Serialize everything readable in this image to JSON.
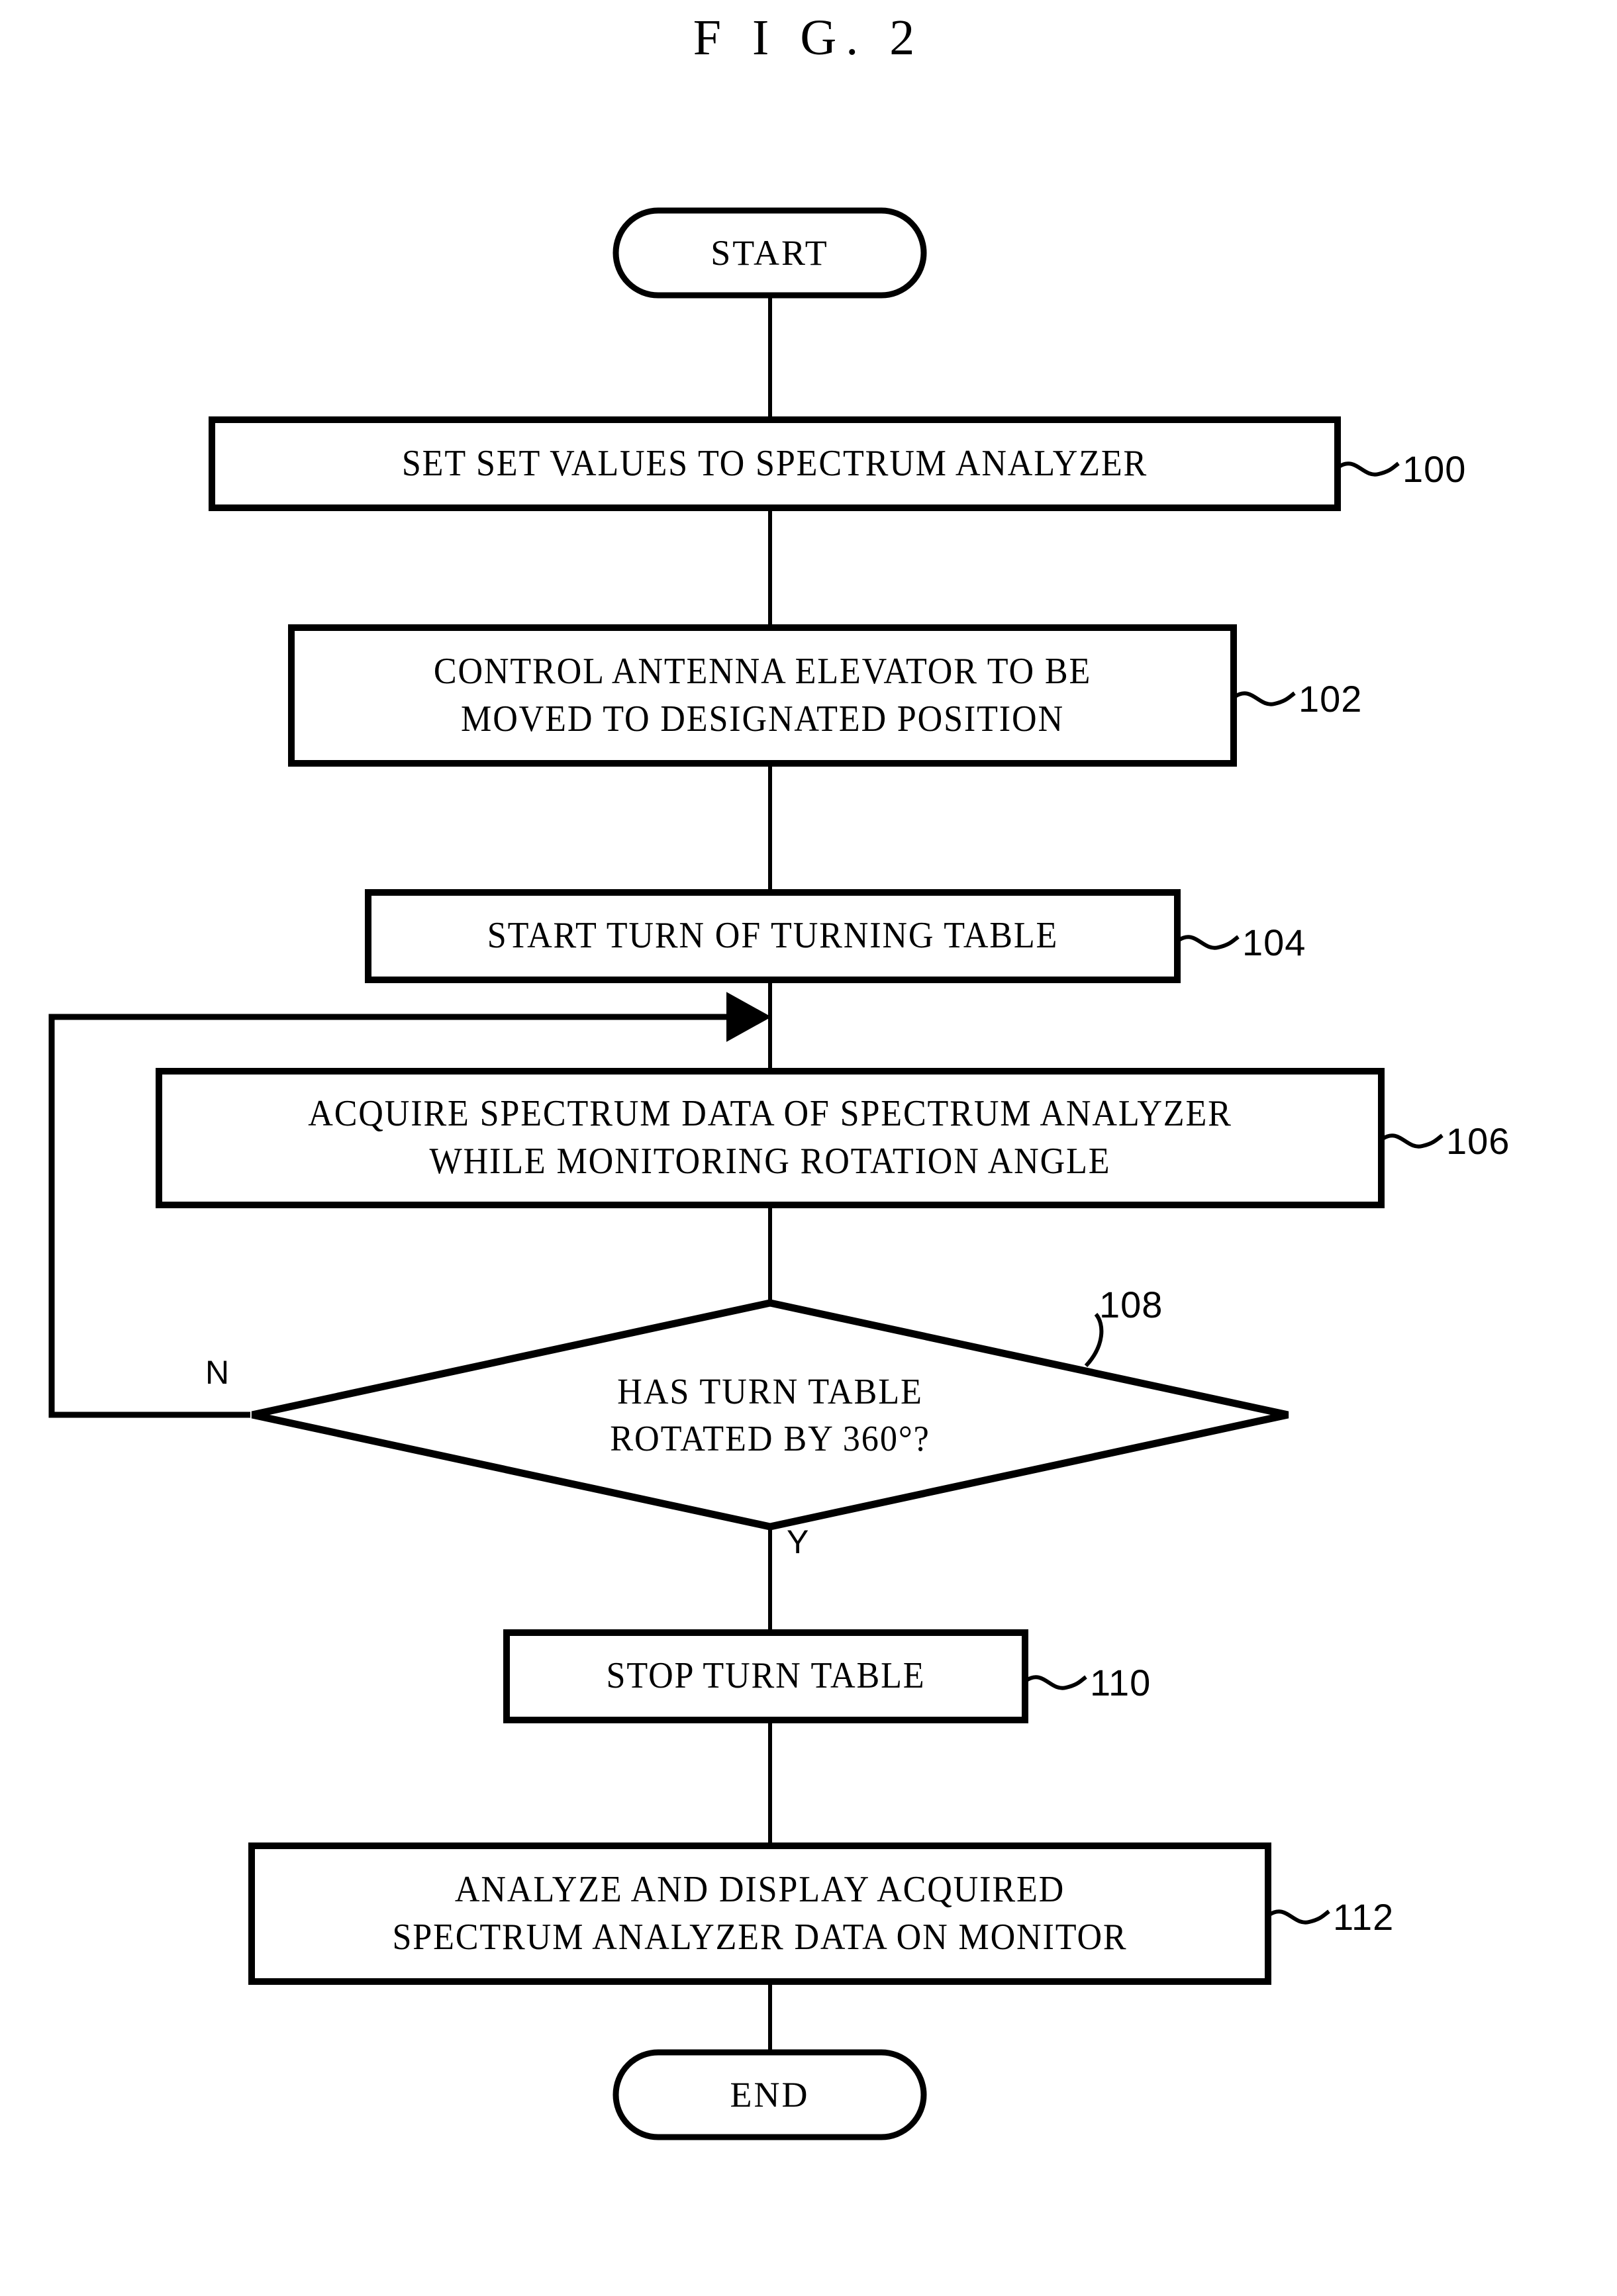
{
  "figure": {
    "title": "F I G. 2"
  },
  "flowchart": {
    "type": "flowchart",
    "orientation": "top-to-bottom",
    "nodes": [
      {
        "id": "start",
        "shape": "terminator",
        "label": "START",
        "ref": ""
      },
      {
        "id": "s100",
        "shape": "process",
        "label": "SET SET VALUES TO SPECTRUM ANALYZER",
        "ref": "100"
      },
      {
        "id": "s102",
        "shape": "process",
        "label_line1": "CONTROL ANTENNA ELEVATOR TO BE",
        "label_line2": "MOVED TO DESIGNATED POSITION",
        "ref": "102"
      },
      {
        "id": "s104",
        "shape": "process",
        "label": "START TURN OF TURNING TABLE",
        "ref": "104"
      },
      {
        "id": "s106",
        "shape": "process",
        "label_line1": "ACQUIRE SPECTRUM DATA OF SPECTRUM ANALYZER",
        "label_line2": "WHILE MONITORING  ROTATION ANGLE",
        "ref": "106"
      },
      {
        "id": "s108",
        "shape": "decision",
        "label_line1": "HAS TURN TABLE",
        "label_line2": "ROTATED BY 360°?",
        "ref": "108",
        "branch_no": "N",
        "branch_yes": "Y"
      },
      {
        "id": "s110",
        "shape": "process",
        "label": "STOP TURN TABLE",
        "ref": "110"
      },
      {
        "id": "s112",
        "shape": "process",
        "label_line1": "ANALYZE AND DISPLAY ACQUIRED",
        "label_line2": "SPECTRUM ANALYZER DATA ON MONITOR",
        "ref": "112"
      },
      {
        "id": "end",
        "shape": "terminator",
        "label": "END",
        "ref": ""
      }
    ],
    "edges": [
      {
        "from": "start",
        "to": "s100",
        "label": ""
      },
      {
        "from": "s100",
        "to": "s102",
        "label": ""
      },
      {
        "from": "s102",
        "to": "s104",
        "label": ""
      },
      {
        "from": "s104",
        "to": "s106",
        "label": ""
      },
      {
        "from": "s106",
        "to": "s108",
        "label": ""
      },
      {
        "from": "s108",
        "to": "s106",
        "label": "N"
      },
      {
        "from": "s108",
        "to": "s110",
        "label": "Y"
      },
      {
        "from": "s110",
        "to": "s112",
        "label": ""
      },
      {
        "from": "s112",
        "to": "end",
        "label": ""
      }
    ]
  },
  "colors": {
    "ink": "#000000",
    "paper": "#ffffff"
  }
}
